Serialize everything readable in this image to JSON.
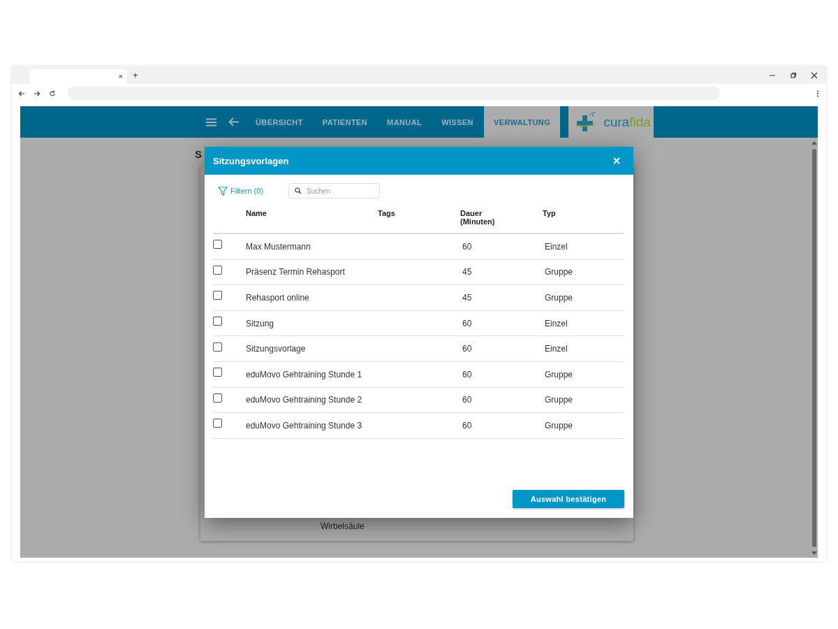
{
  "browser": {
    "tab_close": "×",
    "new_tab": "+"
  },
  "nav": {
    "items": [
      {
        "label": "ÜBERSICHT",
        "selected": false
      },
      {
        "label": "PATIENTEN",
        "selected": false
      },
      {
        "label": "MANUAL",
        "selected": false
      },
      {
        "label": "WISSEN",
        "selected": false
      },
      {
        "label": "VERWALTUNG",
        "selected": true
      }
    ],
    "logo": {
      "part_1": "cura",
      "part_2": "fida"
    }
  },
  "background": {
    "heading": "S",
    "item": "Wirbelsäule"
  },
  "dialog": {
    "title": "Sitzungsvorlagen",
    "filter": "Filtern (0)",
    "search": {
      "placeholder": "Suchen"
    },
    "columns": [
      "Name",
      "Tags",
      "Dauer (Minuten)",
      "Typ"
    ],
    "rows": [
      {
        "checked": false,
        "name": "Max Mustermann",
        "duration": "60",
        "type": "Einzel"
      },
      {
        "checked": false,
        "name": "Präsenz Termin Rehasport",
        "duration": "45",
        "type": "Gruppe"
      },
      {
        "checked": false,
        "name": "Rehasport online",
        "duration": "45",
        "type": "Gruppe"
      },
      {
        "checked": false,
        "name": "Sitzung",
        "duration": "60",
        "type": "Einzel"
      },
      {
        "checked": false,
        "name": "Sitzungsvorlage",
        "duration": "60",
        "type": "Einzel"
      },
      {
        "checked": false,
        "name": "eduMovo Gehtraining Stunde 1",
        "duration": "60",
        "type": "Gruppe"
      },
      {
        "checked": false,
        "name": "eduMovo Gehtraining Stunde 2",
        "duration": "60",
        "type": "Gruppe"
      },
      {
        "checked": false,
        "name": "eduMovo Gehtraining Stunde 3",
        "duration": "60",
        "type": "Gruppe"
      }
    ],
    "confirm": "Auswahl bestätigen"
  }
}
